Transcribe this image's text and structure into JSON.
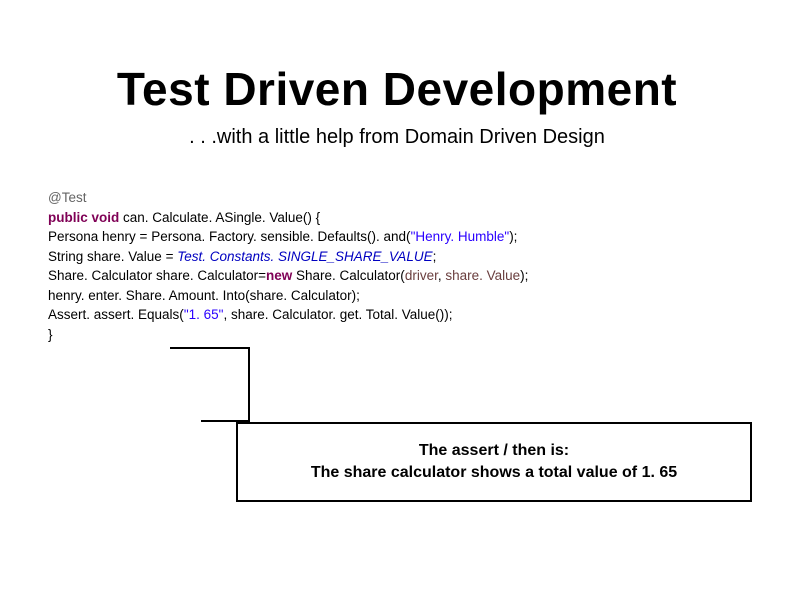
{
  "title": "Test Driven Development",
  "subtitle": ". . .with a little help from Domain Driven Design",
  "code": {
    "l1_ann": "@Test",
    "l2_kw": "public void",
    "l2_rest": " can. Calculate. ASingle. Value() { ",
    "l3a": "Persona henry = Persona. Factory. sensible. Defaults(). and(",
    "l3b": "\"Henry. Humble\"",
    "l3c": "); ",
    "l4a": "String share. Value = ",
    "l4b": "Test. Constants. SINGLE_SHARE_VALUE",
    "l4c": "; ",
    "l5a": "Share. Calculator share. Calculator=",
    "l5b": "new",
    "l5c": " Share. Calculator(",
    "l5d": "driver",
    "l5e": ", ",
    "l5f": "share. Value",
    "l5g": "); ",
    "l6": "henry. enter. Share. Amount. Into(share. Calculator); ",
    "l7a": "Assert. assert. Equals(",
    "l7b": "\"1. 65\"",
    "l7c": ", share. Calculator. get. Total. Value()); ",
    "l8": "} "
  },
  "callout": {
    "line1": "The assert / then is:",
    "line2": "The share calculator shows a total value of 1. 65"
  }
}
